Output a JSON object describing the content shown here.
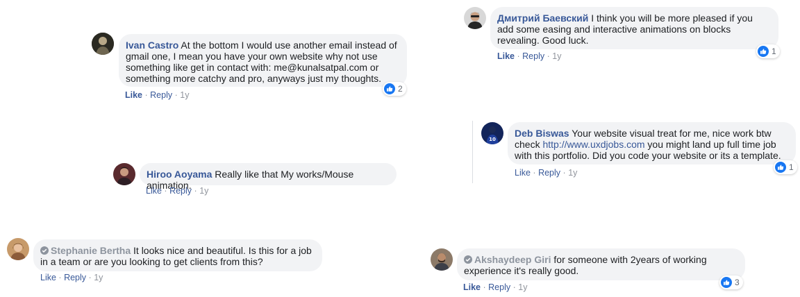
{
  "comments": [
    {
      "author": "Ivan Castro",
      "text": "At the bottom I would use another email instead of gmail one, I mean you have your own website why not use something like get in contact with: me@kunalsatpal.com or something more catchy and pro, anyways just my thoughts.",
      "like_label": "Like",
      "reply_label": "Reply",
      "time": "1y",
      "reaction_count": "2"
    },
    {
      "author": "Hiroo Aoyama",
      "text": "Really like that My works/Mouse animation.",
      "like_label": "Like",
      "reply_label": "Reply",
      "time": "1y"
    },
    {
      "author": "Stephanie Bertha",
      "text": "It looks nice and beautiful. Is this for a job in a team or are you looking to get clients from this?",
      "like_label": "Like",
      "reply_label": "Reply",
      "time": "1y"
    },
    {
      "author": "Дмитрий Баевский",
      "text": "I think you will be more pleased if you add some easing and interactive animations on blocks revealing. Good luck.",
      "like_label": "Like",
      "reply_label": "Reply",
      "time": "1y",
      "reaction_count": "1"
    },
    {
      "author": "Deb Biswas",
      "text_before": "Your website visual treat for me, nice work btw check",
      "link_text": "http://www.uxdjobs.com",
      "text_after": "you might land up full time job with this portfolio. Did you code your website or its a template.",
      "like_label": "Like",
      "reply_label": "Reply",
      "time": "1y",
      "reaction_count": "1"
    },
    {
      "author": "Akshaydeep Giri",
      "text": "for someone with 2years of working experience it's really good.",
      "like_label": "Like",
      "reply_label": "Reply",
      "time": "1y",
      "reaction_count": "3"
    }
  ],
  "separator": "·",
  "colors": {
    "author": "#385898",
    "bubble": "#f2f3f5",
    "like_blue": "#1877f2",
    "muted": "#90949c"
  }
}
